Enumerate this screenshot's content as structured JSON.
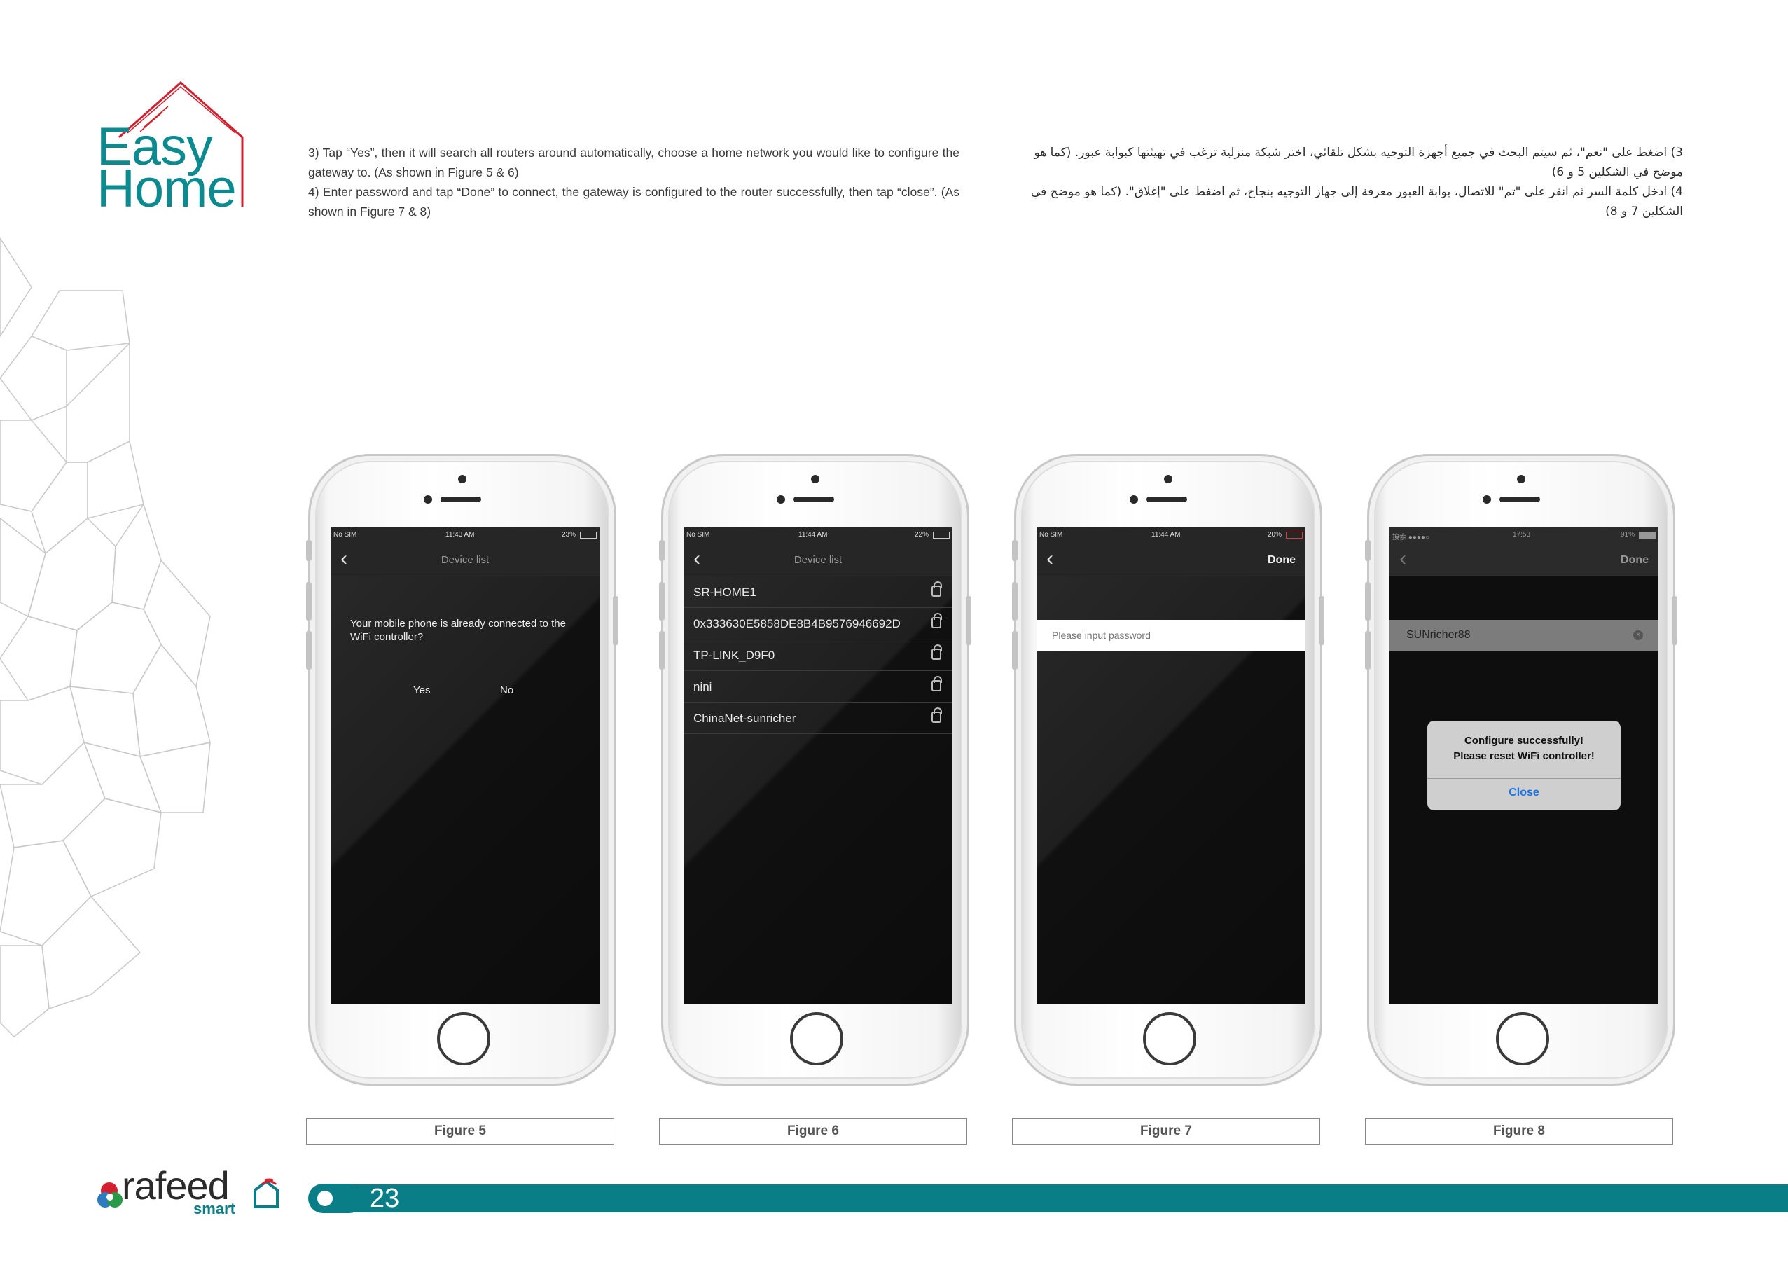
{
  "logo": {
    "line1": "Easy",
    "line2": "Home"
  },
  "text_en": {
    "p3": "3) Tap “Yes”, then it will search all routers around automatically, choose a home network you would like to configure the gateway to. (As shown in Figure 5 & 6)",
    "p4": "4) Enter password and tap “Done” to connect, the gateway is configured to the router successfully, then tap “close”. (As shown in Figure 7 & 8)"
  },
  "text_ar": {
    "p3": "3) اضغط على \"نعم\"، ثم سيتم البحث في جميع أجهزة التوجيه بشكل تلقائي، اختر شبكة منزلية ترغب في تهيئتها كبوابة عبور. (كما هو موضح في الشكلين 5 و 6)",
    "p4": "4) ادخل كلمة السر ثم انقر على \"تم\" للاتصال، بوابة العبور معرفة إلى جهاز التوجيه بنجاح، ثم اضغط على \"إغلاق\". (كما هو موضح في الشكلين 7 و 8)"
  },
  "phones": [
    {
      "status": {
        "carrier": "No SIM",
        "time": "11:43 AM",
        "battery": "23%"
      },
      "nav_title": "Device list",
      "dialog": {
        "message": "Your mobile phone is already connected to the WiFi controller?",
        "yes": "Yes",
        "no": "No"
      },
      "caption": "Figure 5"
    },
    {
      "status": {
        "carrier": "No SIM",
        "time": "11:44 AM",
        "battery": "22%"
      },
      "nav_title": "Device list",
      "networks": [
        "SR-HOME1",
        "0x333630E5858DE8B4B9576946692D",
        "TP-LINK_D9F0",
        "nini",
        "ChinaNet-sunricher"
      ],
      "caption": "Figure 6"
    },
    {
      "status": {
        "carrier": "No SIM",
        "time": "11:44 AM",
        "battery": "20%"
      },
      "nav_done": "Done",
      "password_placeholder": "Please input password",
      "caption": "Figure 7"
    },
    {
      "status": {
        "carrier": "搜索 ●●●●○",
        "time": "17:53",
        "battery": "91%"
      },
      "nav_done": "Done",
      "password_value": "SUNricher88",
      "alert": {
        "line1": "Configure successfully!",
        "line2": "Please reset WiFi controller!",
        "button": "Close"
      },
      "caption": "Figure 8"
    }
  ],
  "footer": {
    "page_number": "23",
    "brand": "rafeed",
    "brand_sub": "smart"
  },
  "colors": {
    "teal": "#0a7e86",
    "roof": "#d2202f"
  }
}
